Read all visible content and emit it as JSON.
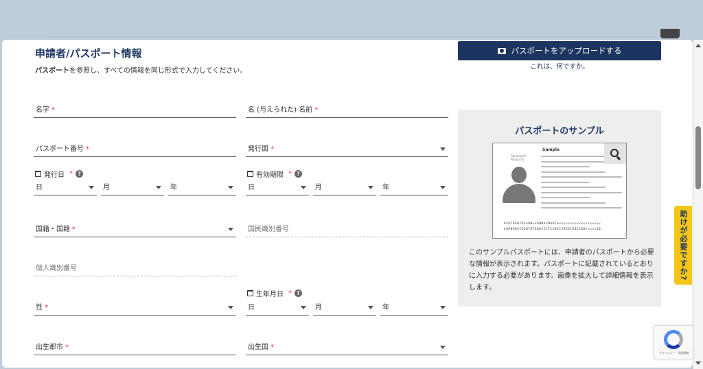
{
  "section": {
    "title": "申請者/パスポート情報",
    "desc_bold": "パスポート",
    "desc_rest": "を参照し、すべての情報を同じ形式で入力してください。"
  },
  "fields": {
    "surname": "名字",
    "given_name": "名 (与えられた) 名前",
    "passport_number": "パスポート番号",
    "issuing_country": "発行国",
    "issue_date": "発行日",
    "expiry_date": "有効期限",
    "nationality": "国籍・国籍",
    "national_id": "国民識別番号",
    "personal_id": "個人識別番号",
    "sex": "性",
    "birth_date": "生年月日",
    "birth_city": "出生都市",
    "birth_country": "出生国",
    "required_mark": "*"
  },
  "date_parts": {
    "day": "日",
    "month": "月",
    "year": "年"
  },
  "upload": {
    "button_label": "パスポートをアップロードする",
    "what_link": "これは、何ですか。"
  },
  "sample": {
    "title": "パスポートのサンプル",
    "pp_heading": "Sample",
    "pp_sub1": "Passeport",
    "pp_sub2": "Passport",
    "mrz1": "P<UTOERIKSSON<<ANNA<MARIA<<<<<<<<<<<<<<<<<<<",
    "mrz2": "L898902C36UTO7408122F1204159ZE184226B<<<<<10",
    "description": "このサンプルパスポートには、申請者のパスポートから必要な情報が表示されます。パスポートに記載されているとおりに入力する必要があります。画像を拡大して詳細情報を表示します。"
  },
  "help_tab": "助けが必要ですか?",
  "recaptcha": "プライバシー - 利用規約",
  "icons": {
    "calendar": "calendar-icon",
    "help": "question-circle-icon",
    "camera": "camera-icon",
    "zoom": "magnifier-icon",
    "avatar": "person-silhouette-icon",
    "recaptcha": "recaptcha-logo-icon"
  },
  "colors": {
    "primary": "#1c3460",
    "title": "#1e3a63",
    "required": "#dd3333",
    "help_tab_bg": "#f5c518"
  }
}
